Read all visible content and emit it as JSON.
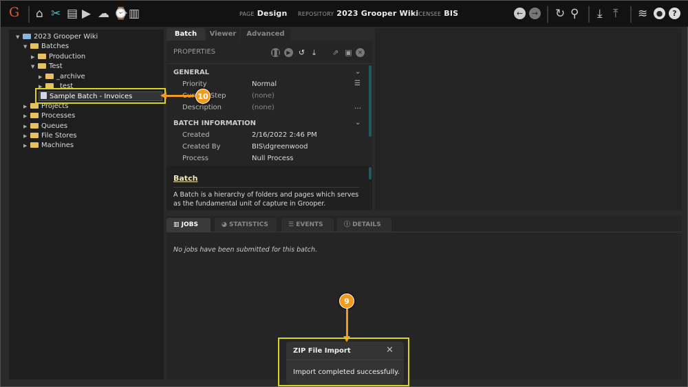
{
  "app": {
    "logo": "G",
    "toolbar_icons": [
      "home-icon",
      "tools-icon",
      "archive-icon",
      "batch-play-icon",
      "cloud-upload-icon",
      "briefcase-clock-icon",
      "bar-chart-icon"
    ],
    "page_label": "PAGE",
    "page": "Design",
    "repository_label": "REPOSITORY",
    "repository": "2023 Grooper Wiki",
    "licensee_label": "LICENSEE",
    "licensee": "BIS",
    "right_icons": [
      "back-icon",
      "forward-icon",
      "refresh-icon",
      "search-icon",
      "download-icon",
      "upload-icon",
      "database-icon",
      "user-icon",
      "help-icon"
    ]
  },
  "tree": [
    {
      "label": "2023 Grooper Wiki",
      "depth": 0,
      "expanded": true,
      "type": "repo"
    },
    {
      "label": "Batches",
      "depth": 1,
      "expanded": true,
      "type": "folder"
    },
    {
      "label": "Production",
      "depth": 2,
      "expanded": false,
      "type": "folder"
    },
    {
      "label": "Test",
      "depth": 2,
      "expanded": true,
      "type": "folder"
    },
    {
      "label": "_archive",
      "depth": 3,
      "expanded": false,
      "type": "folder"
    },
    {
      "label": "_test",
      "depth": 3,
      "expanded": false,
      "type": "folder"
    },
    {
      "label": "Sample Batch - Invoices",
      "depth": 3,
      "expanded": false,
      "type": "batch",
      "selected": true
    },
    {
      "label": "Projects",
      "depth": 1,
      "expanded": false,
      "type": "folder"
    },
    {
      "label": "Processes",
      "depth": 1,
      "expanded": false,
      "type": "folder"
    },
    {
      "label": "Queues",
      "depth": 1,
      "expanded": false,
      "type": "folder"
    },
    {
      "label": "File Stores",
      "depth": 1,
      "expanded": false,
      "type": "folder"
    },
    {
      "label": "Machines",
      "depth": 1,
      "expanded": false,
      "type": "folder"
    }
  ],
  "tabs": [
    "Batch",
    "Viewer",
    "Advanced"
  ],
  "properties": {
    "title": "PROPERTIES",
    "general": "GENERAL",
    "priority_l": "Priority",
    "priority": "Normal",
    "step_l": "Current Step",
    "step": "(none)",
    "desc_l": "Description",
    "desc": "(none)",
    "info": "BATCH INFORMATION",
    "created_l": "Created",
    "created": "2/16/2022 2:46 PM",
    "by_l": "Created By",
    "by": "BIS\\dgreenwood",
    "process_l": "Process",
    "process": "Null Process",
    "help_title": "Batch",
    "help_text": "A Batch is a hierarchy of folders and pages which serves as the fundamental unit of capture in Grooper."
  },
  "bottom": {
    "tabs": [
      "JOBS",
      "STATISTICS",
      "EVENTS",
      "DETAILS"
    ],
    "empty": "No jobs have been submitted for this batch."
  },
  "toast": {
    "title": "ZIP File Import",
    "message": "Import completed successfully."
  },
  "callouts": {
    "a": "10",
    "b": "9"
  },
  "colors": {
    "accent": "#f39a1c",
    "highlight": "#d9d21e"
  }
}
